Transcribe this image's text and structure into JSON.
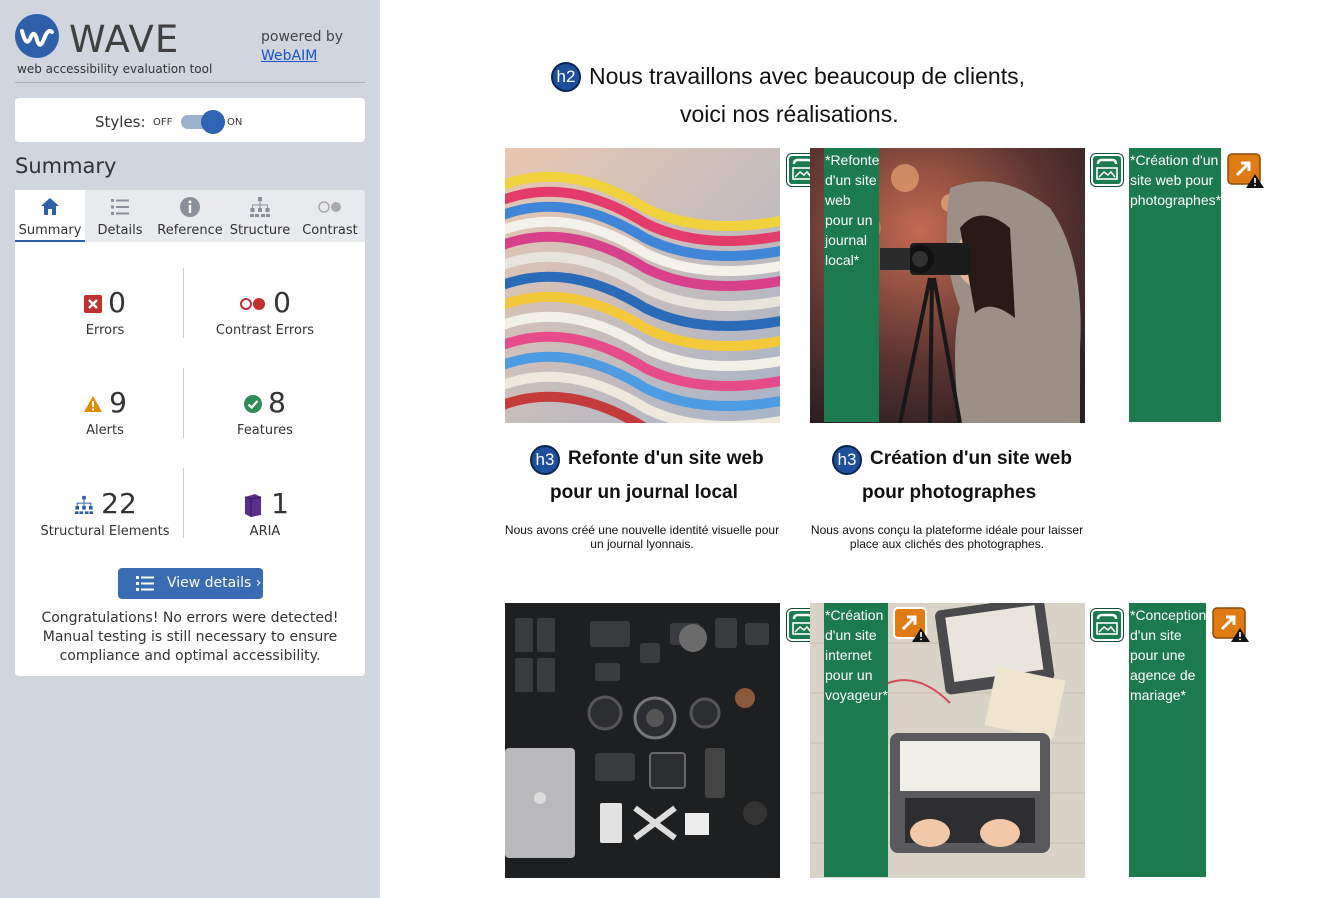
{
  "wave": {
    "logo_text": "WAVE",
    "tagline": "web accessibility evaluation tool",
    "powered_by": "powered by",
    "webaim_link": "WebAIM",
    "styles_label": "Styles:",
    "styles_off": "OFF",
    "styles_on": "ON",
    "summary_heading": "Summary",
    "tabs": [
      {
        "label": "Summary",
        "icon": "home-icon",
        "active": true
      },
      {
        "label": "Details",
        "icon": "list-icon",
        "active": false
      },
      {
        "label": "Reference",
        "icon": "info-icon",
        "active": false
      },
      {
        "label": "Structure",
        "icon": "sitemap-icon",
        "active": false
      },
      {
        "label": "Contrast",
        "icon": "contrast-icon",
        "active": false
      }
    ],
    "stats": {
      "errors": {
        "count": "0",
        "label": "Errors",
        "color": "#c03030"
      },
      "contrast_errors": {
        "count": "0",
        "label": "Contrast Errors",
        "color": "#c03030"
      },
      "alerts": {
        "count": "9",
        "label": "Alerts",
        "color": "#e08a00"
      },
      "features": {
        "count": "8",
        "label": "Features",
        "color": "#2e8b57"
      },
      "structural": {
        "count": "22",
        "label": "Structural Elements",
        "color": "#2f5fa8"
      },
      "aria": {
        "count": "1",
        "label": "ARIA",
        "color": "#5b2d8e"
      }
    },
    "view_details": "View details ›",
    "congrats": "Congratulations! No errors were detected! Manual testing is still necessary to ensure compliance and optimal accessibility."
  },
  "page": {
    "heading_line1": "Nous travaillons avec beaucoup de clients,",
    "heading_line2": "voici nos réalisations.",
    "h2_badge": "h2",
    "h3_badge": "h3",
    "projects": [
      {
        "title_line1": "Refonte d'un site web",
        "title_line2": "pour un journal local",
        "desc": "Nous avons créé une nouvelle identité visuelle pour un journal lyonnais.",
        "alt_text": "*Refonte d'un site web pour un journal local*"
      },
      {
        "title_line1": "Création d'un site web",
        "title_line2": "pour photographes",
        "desc": "Nous avons conçu la plateforme idéale pour laisser place aux clichés des photographes.",
        "alt_text": "*Création d'un site web pour photographes*"
      },
      {
        "alt_text": "*Création d'un site internet pour un voyageur*"
      },
      {
        "alt_text": "*Conception d'un site pour une agence de mariage*"
      }
    ]
  }
}
